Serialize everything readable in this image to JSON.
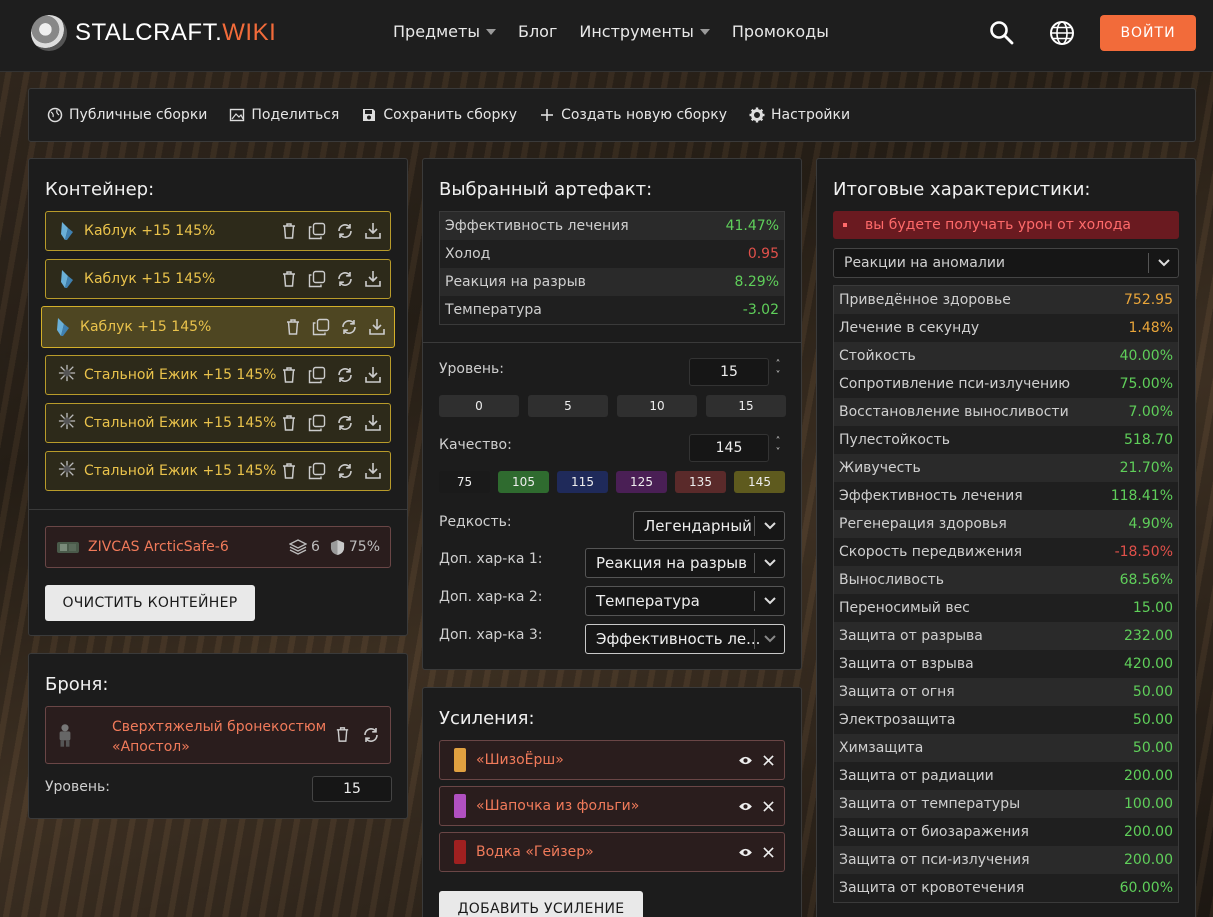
{
  "header": {
    "logo_main": "STALCRAFT.",
    "logo_accent": "WIKI",
    "nav": {
      "items": "Предметы",
      "blog": "Блог",
      "tools": "Инструменты",
      "promo": "Промокоды"
    },
    "login_label": "ВОЙТИ"
  },
  "toolbar": {
    "public_builds": "Публичные сборки",
    "share": "Поделиться",
    "save_build": "Сохранить сборку",
    "new_build": "Создать новую сборку",
    "settings": "Настройки"
  },
  "container": {
    "title": "Контейнер:",
    "slots": [
      {
        "name": "Каблук +15 145%"
      },
      {
        "name": "Каблук +15 145%"
      },
      {
        "name": "Каблук +15 145%"
      },
      {
        "name": "Стальной Ежик +15 145%"
      },
      {
        "name": "Стальной Ежик +15 145%"
      },
      {
        "name": "Стальной Ежик +15 145%"
      }
    ],
    "item_name": "ZIVCAS ArcticSafe-6",
    "capacity": "6",
    "protection": "75%",
    "clear_label": "ОЧИСТИТЬ КОНТЕЙНЕР"
  },
  "armor": {
    "title": "Броня:",
    "item_name": "Сверхтяжелый бронекостюм «Апостол»",
    "level_label": "Уровень:",
    "level_value": "15"
  },
  "artifact": {
    "title": "Выбранный артефакт:",
    "stats": [
      {
        "label": "Эффективность лечения",
        "value": "41.47%",
        "tone": "pos"
      },
      {
        "label": "Холод",
        "value": "0.95",
        "tone": "neg"
      },
      {
        "label": "Реакция на разрыв",
        "value": "8.29%",
        "tone": "pos"
      },
      {
        "label": "Температура",
        "value": "-3.02",
        "tone": "pos"
      }
    ],
    "level_label": "Уровень:",
    "level_value": "15",
    "level_presets": [
      "0",
      "5",
      "10",
      "15"
    ],
    "quality_label": "Качество:",
    "quality_value": "145",
    "quality_presets": [
      {
        "label": "75",
        "color": "#1a1a1a"
      },
      {
        "label": "105",
        "color": "#2f6b2f"
      },
      {
        "label": "115",
        "color": "#1f2a5a"
      },
      {
        "label": "125",
        "color": "#4a1f55"
      },
      {
        "label": "135",
        "color": "#5a2a2a"
      },
      {
        "label": "145",
        "color": "#5e5a1e"
      }
    ],
    "rarity_label": "Редкость:",
    "rarity_value": "Легендарный",
    "extra1_label": "Доп. хар-ка 1:",
    "extra1_value": "Реакция на разрыв",
    "extra2_label": "Доп. хар-ка 2:",
    "extra2_value": "Температура",
    "extra3_label": "Доп. хар-ка 3:",
    "extra3_value": "Эффективность ле..."
  },
  "boosts": {
    "title": "Усиления:",
    "items": [
      {
        "name": "«ШизоЁрш»",
        "color": "#e0a040"
      },
      {
        "name": "«Шапочка из фольги»",
        "color": "#b050c0"
      },
      {
        "name": "Водка «Гейзер»",
        "color": "#a02020"
      }
    ],
    "add_label": "ДОБАВИТЬ УСИЛЕНИЕ"
  },
  "totals": {
    "title": "Итоговые характеристики:",
    "warning": "вы будете получать урон от холода",
    "filter_value": "Реакции на аномалии",
    "rows": [
      {
        "label": "Приведённое здоровье",
        "value": "752.95",
        "tone": "gold"
      },
      {
        "label": "Лечение в секунду",
        "value": "1.48%",
        "tone": "gold"
      },
      {
        "label": "Стойкость",
        "value": "40.00%",
        "tone": "pos"
      },
      {
        "label": "Сопротивление пси-излучению",
        "value": "75.00%",
        "tone": "pos"
      },
      {
        "label": "Восстановление выносливости",
        "value": "7.00%",
        "tone": "pos"
      },
      {
        "label": "Пулестойкость",
        "value": "518.70",
        "tone": "pos"
      },
      {
        "label": "Живучесть",
        "value": "21.70%",
        "tone": "pos"
      },
      {
        "label": "Эффективность лечения",
        "value": "118.41%",
        "tone": "pos"
      },
      {
        "label": "Регенерация здоровья",
        "value": "4.90%",
        "tone": "pos"
      },
      {
        "label": "Скорость передвижения",
        "value": "-18.50%",
        "tone": "neg"
      },
      {
        "label": "Выносливость",
        "value": "68.56%",
        "tone": "pos"
      },
      {
        "label": "Переносимый вес",
        "value": "15.00",
        "tone": "pos"
      },
      {
        "label": "Защита от разрыва",
        "value": "232.00",
        "tone": "pos"
      },
      {
        "label": "Защита от взрыва",
        "value": "420.00",
        "tone": "pos"
      },
      {
        "label": "Защита от огня",
        "value": "50.00",
        "tone": "pos"
      },
      {
        "label": "Электрозащита",
        "value": "50.00",
        "tone": "pos"
      },
      {
        "label": "Химзащита",
        "value": "50.00",
        "tone": "pos"
      },
      {
        "label": "Защита от радиации",
        "value": "200.00",
        "tone": "pos"
      },
      {
        "label": "Защита от температуры",
        "value": "100.00",
        "tone": "pos"
      },
      {
        "label": "Защита от биозаражения",
        "value": "200.00",
        "tone": "pos"
      },
      {
        "label": "Защита от пси-излучения",
        "value": "200.00",
        "tone": "pos"
      },
      {
        "label": "Защита от кровотечения",
        "value": "60.00%",
        "tone": "pos"
      }
    ]
  }
}
